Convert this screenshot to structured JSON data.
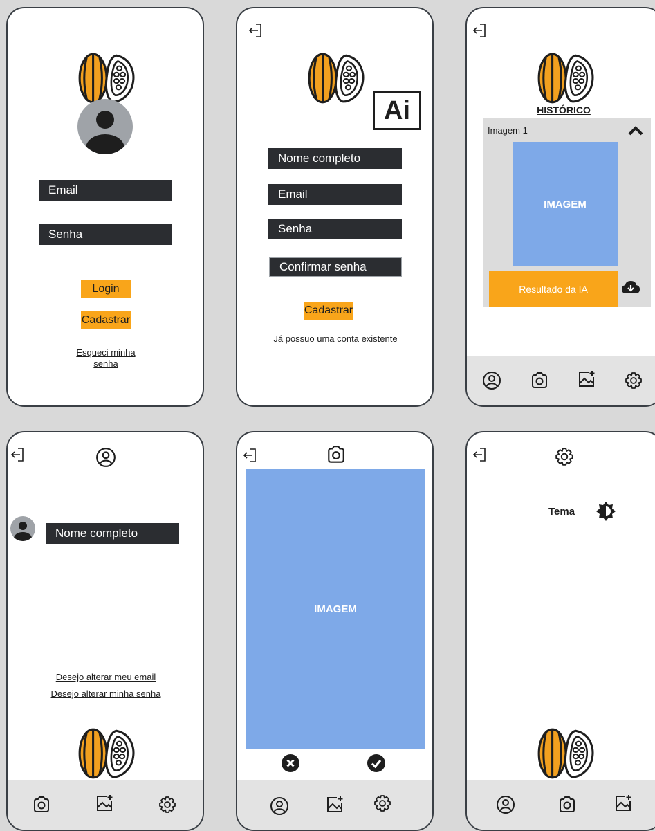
{
  "colors": {
    "accent": "#f9a51a",
    "field": "#2b2d31",
    "image": "#7ea9e8",
    "nav": "#e3e3e3",
    "background": "#d9d9d9"
  },
  "login": {
    "email_label": "Email",
    "password_label": "Senha",
    "login_button": "Login",
    "register_button": "Cadastrar",
    "forgot_line1": "Esqueci minha",
    "forgot_line2": "senha"
  },
  "register": {
    "ai_badge": "Ai",
    "name_label": "Nome completo",
    "email_label": "Email",
    "password_label": "Senha",
    "confirm_label": "Confirmar senha",
    "register_button": "Cadastrar",
    "existing_link": "Já possuo uma conta existente"
  },
  "history": {
    "title": "HISTÓRICO",
    "item_label": "Imagem 1",
    "image_label": "IMAGEM",
    "result_label": "Resultado da IA"
  },
  "profile": {
    "name_label": "Nome completo",
    "change_email": "Desejo alterar meu email",
    "change_password": "Desejo alterar minha senha"
  },
  "camera": {
    "image_label": "IMAGEM"
  },
  "settings": {
    "theme_label": "Tema"
  },
  "icons": [
    "logout-icon",
    "user-icon",
    "camera-icon",
    "gallery-add-icon",
    "settings-icon",
    "cloud-download-icon",
    "chevron-up-icon",
    "cancel-icon",
    "confirm-icon",
    "theme-icon",
    "cocoa-logo"
  ]
}
